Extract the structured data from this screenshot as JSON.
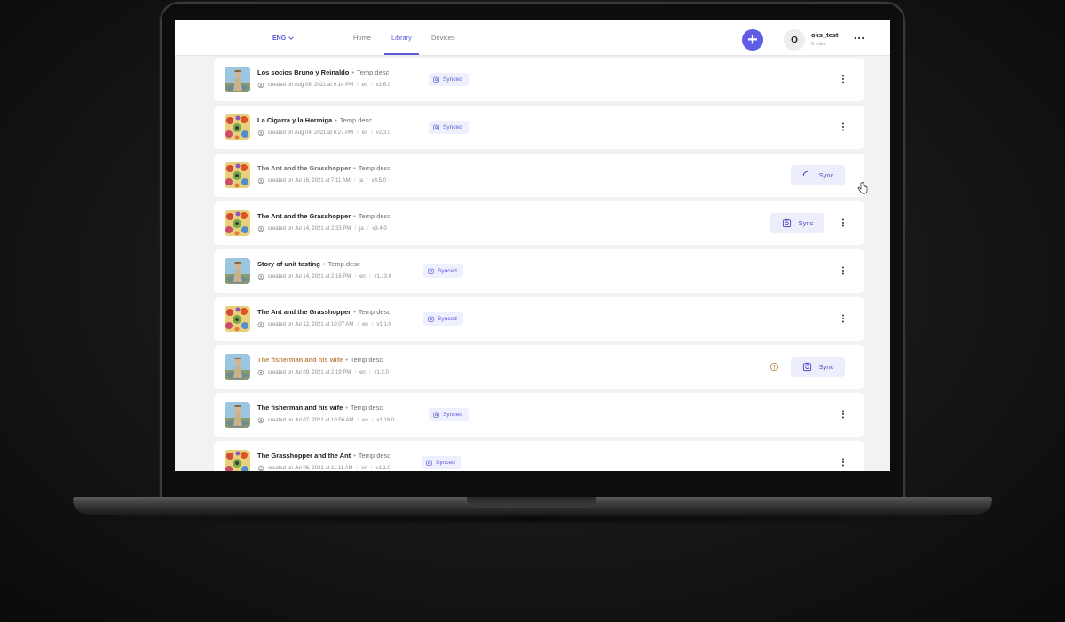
{
  "header": {
    "language": "ENG",
    "nav": {
      "home": "Home",
      "library": "Library",
      "devices": "Devices"
    },
    "add_label": "+",
    "user": {
      "initial": "O",
      "name": "oks_test",
      "roles": "5 roles"
    }
  },
  "rows": [
    {
      "title": "Los socios Bruno y Reinaldo",
      "desc": "Temp desc",
      "created": "created on Aug 06, 2021 at 9:14 PM",
      "lang": "es",
      "version": "v2.6.0",
      "status": "Synced",
      "thumb": "pond"
    },
    {
      "title": "La Cigarra y la Hormiga",
      "desc": "Temp desc",
      "created": "created on Aug 04, 2021 at 6:27 PM",
      "lang": "es",
      "version": "v2.3.0",
      "status": "Synced",
      "thumb": "flowers"
    },
    {
      "title": "The Ant and the Grasshopper",
      "desc": "Temp desc",
      "created": "created on Jul 16, 2021 at 7:11 AM",
      "lang": "ja",
      "version": "v3.5.0",
      "status": "Sync",
      "thumb": "flowers"
    },
    {
      "title": "The Ant and the Grasshopper",
      "desc": "Temp desc",
      "created": "created on Jul 14, 2021 at 2:33 PM",
      "lang": "ja",
      "version": "v3.4.0",
      "status": "Sync",
      "thumb": "flowers"
    },
    {
      "title": "Story of unit testing",
      "desc": "Temp desc",
      "created": "created on Jul 14, 2021 at 2:16 PM",
      "lang": "en",
      "version": "v1.13.0",
      "status": "Synced",
      "thumb": "pond"
    },
    {
      "title": "The Ant and the Grasshopper",
      "desc": "Temp desc",
      "created": "created on Jul 12, 2021 at 10:07 AM",
      "lang": "en",
      "version": "v1.1.0",
      "status": "Synced",
      "thumb": "flowers"
    },
    {
      "title": "The fisherman and his wife",
      "desc": "Temp desc",
      "created": "created on Jul 09, 2021 at 2:19 PM",
      "lang": "en",
      "version": "v1.2.0",
      "status": "Sync",
      "thumb": "pond"
    },
    {
      "title": "The fisherman and his wife",
      "desc": "Temp desc",
      "created": "created on Jul 07, 2021 at 10:56 AM",
      "lang": "en",
      "version": "v1.18.0",
      "status": "Synced",
      "thumb": "pond"
    },
    {
      "title": "The Grasshopper and the Ant",
      "desc": "Temp desc",
      "created": "created on Jul 06, 2021 at 11:11 AM",
      "lang": "en",
      "version": "v1.1.0",
      "status": "Synced",
      "thumb": "flowers"
    }
  ],
  "colors": {
    "accent": "#5f5ce6",
    "warning": "#c08a50",
    "synced_bg": "#eef0fd"
  }
}
